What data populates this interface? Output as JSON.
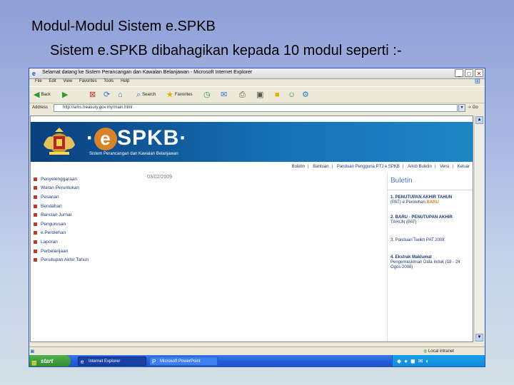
{
  "slide": {
    "title": "Modul-Modul Sistem e.SPKB",
    "subtitle": "Sistem e.SPKB dibahagikan kepada 10 modul seperti :-"
  },
  "browser": {
    "window_title": "Selamat datang ke Sistem Perancangan dan Kawalan Belanjawan - Microsoft Internet Explorer",
    "menu": [
      "File",
      "Edit",
      "View",
      "Favorites",
      "Tools",
      "Help"
    ],
    "toolbar": {
      "back": "Back",
      "search": "Search",
      "favorites": "Favorites"
    },
    "address_label": "Address",
    "address_value": "http://ams.treasury.gov.my/main.html",
    "go_label": "Go",
    "status_zone": "Local intranet"
  },
  "site": {
    "logo_text": "SPKB",
    "logo_e": "e",
    "tagline": "Sistem Perancangan dan Kawalan Belanjawan",
    "nav": [
      "Buletin",
      "Bantuan",
      "Panduan Pengguna PTJ e.SPKB",
      "Arkib Buletin",
      "Versi",
      "Keluar"
    ],
    "menu": [
      "Penyelenggaraan",
      "Waran Peruntukan",
      "Pesanan",
      "Bendahari",
      "Bancian Jurnal",
      "Pengurusan",
      "e.Perolehan",
      "Laporan",
      "Perbelanjaan",
      "Penutupan Akhir Tahun"
    ],
    "date": "03/02/2009",
    "buletin": {
      "heading": "Buletin",
      "items": [
        {
          "title": "1. PENUTUPAN AKHIR TAHUN",
          "detail": "(PAT) e.Perolehan",
          "badge": "BARU"
        },
        {
          "title": "2. BARU - PENUTUPAN AKHIR",
          "detail": "TAHUN (PAT)"
        },
        {
          "title": "3. Panduan Tarikh PAT 2008",
          "detail": ""
        },
        {
          "title": "4. Ekstrak Maklumat",
          "detail": "Pengemaskinian Data Induk (18 - 24 Ogos 2008)"
        }
      ]
    }
  },
  "taskbar": {
    "start": "start",
    "tasks": [
      "Internet Explorer",
      "Microsoft PowerPoint"
    ]
  }
}
